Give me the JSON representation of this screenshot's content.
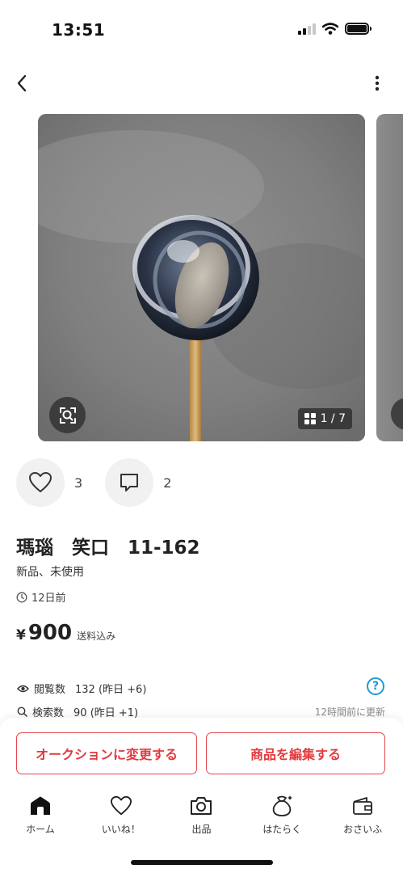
{
  "status_bar": {
    "time": "13:51",
    "icons": [
      "cellular-signal-icon",
      "wifi-icon",
      "battery-icon"
    ]
  },
  "nav": {
    "back_icon": "chevron-left-icon",
    "more_icon": "more-vertical-icon"
  },
  "gallery": {
    "counter": "1 / 7",
    "counter_icon": "grid-icon",
    "lens_icon": "image-search-icon",
    "current_index": 1,
    "total_images": 7
  },
  "social": {
    "like_count": "3",
    "comment_count": "2",
    "like_icon": "heart-icon",
    "comment_icon": "comment-icon"
  },
  "item": {
    "title": "瑪瑙　笑口　11-162",
    "condition": "新品、未使用",
    "posted": "12日前",
    "price_currency": "¥",
    "price": "900",
    "shipping_note": "送料込み"
  },
  "stats": {
    "views_label": "閲覧数",
    "views_value": "132 (昨日 +6)",
    "searches_label": "検索数",
    "searches_value": "90 (昨日 +1)",
    "updated": "12時間前に更新",
    "help_mark": "?"
  },
  "actions": {
    "auction_label": "オークションに変更する",
    "edit_label": "商品を編集する",
    "accent_color": "#e33a3e"
  },
  "tab_bar": {
    "tabs": [
      {
        "label": "ホーム",
        "icon": "home-icon"
      },
      {
        "label": "いいね！",
        "icon": "heart-icon"
      },
      {
        "label": "出品",
        "icon": "camera-icon"
      },
      {
        "label": "はたらく",
        "icon": "money-bag-icon"
      },
      {
        "label": "おさいふ",
        "icon": "wallet-icon"
      }
    ]
  }
}
